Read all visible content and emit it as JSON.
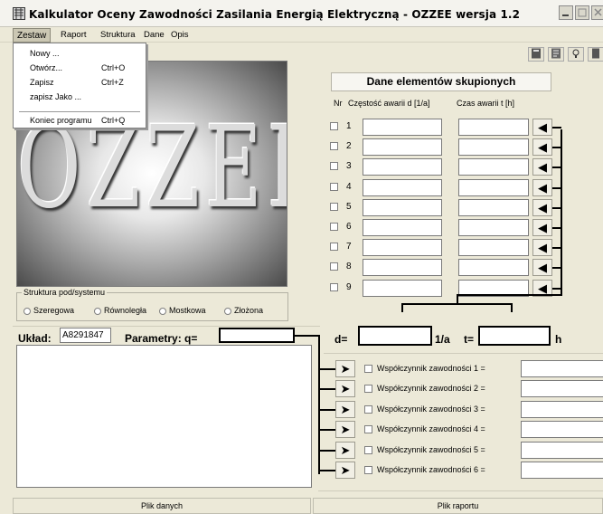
{
  "window": {
    "title": "Kalkulator Oceny Zawodności Zasilania Energią Elektryczną - OZZEE wersja 1.2"
  },
  "menubar": [
    "Zestaw",
    "Raport",
    "Struktura",
    "Dane",
    "Opis"
  ],
  "dropdown": {
    "items": [
      {
        "label": "Nowy ...",
        "shortcut": ""
      },
      {
        "label": "Otwórz...",
        "shortcut": "Ctrl+O"
      },
      {
        "label": "Zapisz",
        "shortcut": "Ctrl+Z"
      },
      {
        "label": "zapisz Jako ...",
        "shortcut": ""
      },
      {
        "label": "Koniec programu",
        "shortcut": "Ctrl+Q"
      }
    ]
  },
  "logo": {
    "text": "OZZEE"
  },
  "structure": {
    "legend": "Struktura pod/systemu",
    "options": [
      "Szeregowa",
      "Równoległa",
      "Mostkowa",
      "Złożona"
    ]
  },
  "uklad": {
    "label": "Układ:",
    "value": "A8291847"
  },
  "parametry": {
    "label": "Parametry: q=",
    "value": ""
  },
  "elements": {
    "header": "Dane elementów skupionych",
    "col_nr": "Nr",
    "col_freq": "Częstość awarii d [1/a]",
    "col_time": "Czas awarii t [h]",
    "rows": [
      "1",
      "2",
      "3",
      "4",
      "5",
      "6",
      "7",
      "8",
      "9"
    ]
  },
  "result": {
    "d_label": "d=",
    "d_unit": "1/a",
    "t_label": "t=",
    "t_unit": "h"
  },
  "factors": [
    "Współczynnik  zawodności 1  =",
    "Współczynnik  zawodności 2  =",
    "Współczynnik  zawodności 3  =",
    "Współczynnik  zawodności 4  =",
    "Współczynnik  zawodności 5  =",
    "Współczynnik  zawodności 6  ="
  ],
  "footer": {
    "left": "Plik danych",
    "right": "Plik raportu"
  },
  "icons": {
    "app": "calculator-app-icon",
    "arrow_left": "◀",
    "arrow_right": "➤"
  }
}
